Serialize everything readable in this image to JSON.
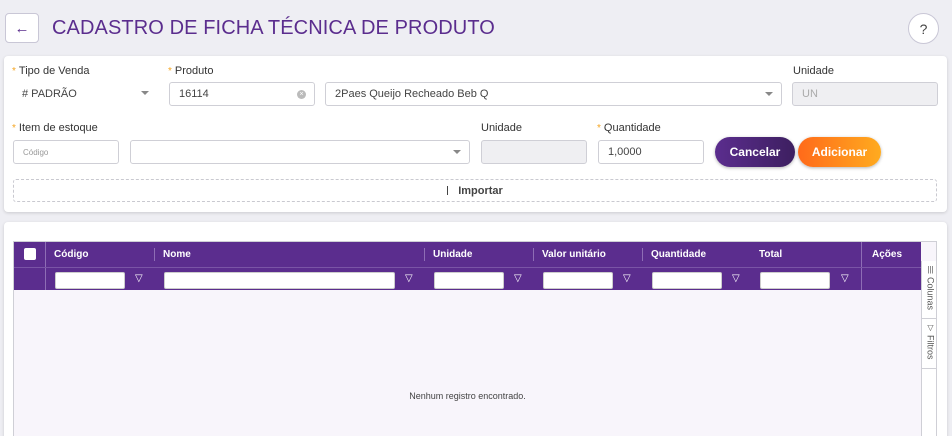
{
  "header": {
    "title": "CADASTRO DE FICHA TÉCNICA DE PRODUTO",
    "back_icon": "←",
    "help_icon": "?"
  },
  "form": {
    "tipo_venda": {
      "label": "Tipo de Venda",
      "value": "# PADRÃO"
    },
    "produto": {
      "label": "Produto",
      "code": "16114",
      "name": "2Paes Queijo Recheado Beb Q"
    },
    "unidade_produto": {
      "label": "Unidade",
      "value": "UN"
    },
    "item_estoque": {
      "label": "Item de estoque",
      "code_placeholder": "Código",
      "value": ""
    },
    "unidade_item": {
      "label": "Unidade",
      "value": ""
    },
    "quantidade": {
      "label": "Quantidade",
      "value": "1,0000"
    },
    "required_mark": "*",
    "cancel_label": "Cancelar",
    "add_label": "Adicionar",
    "import_label": "Importar"
  },
  "grid": {
    "columns": [
      "Código",
      "Nome",
      "Unidade",
      "Valor unitário",
      "Quantidade",
      "Total",
      "Ações"
    ],
    "rows": [],
    "empty_message": "Nenhum registro encontrado.",
    "side_tabs": [
      "Colunas",
      "Filtros"
    ],
    "filter_icon": "▽",
    "columns_icon": "|||"
  },
  "colors": {
    "primary": "#5b2d8e",
    "accent_start": "#ff6a1a",
    "accent_end": "#ffab1f",
    "required": "#f5a623"
  }
}
